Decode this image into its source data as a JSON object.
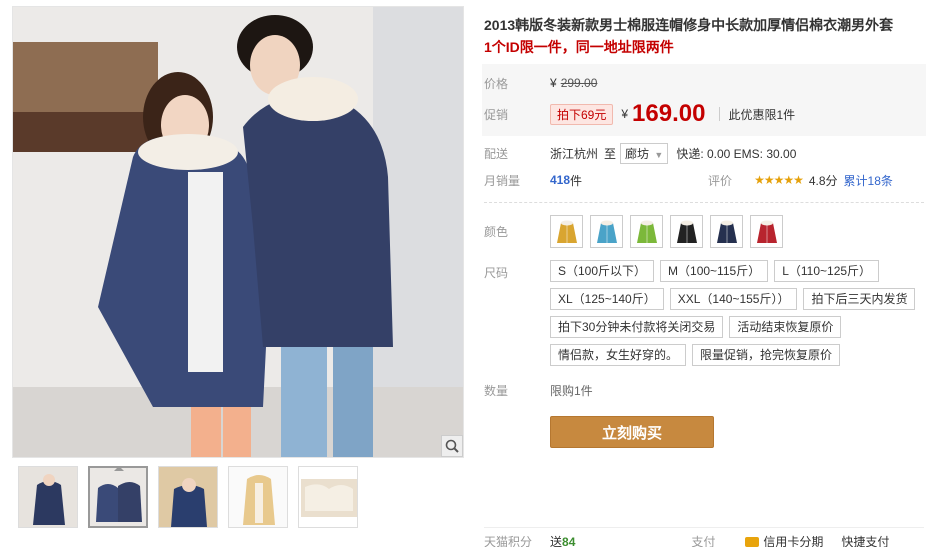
{
  "product": {
    "title": "2013韩版冬装新款男士棉服连帽修身中长款加厚情侣棉衣潮男外套",
    "subtitle": "1个ID限一件，同一地址限两件"
  },
  "price": {
    "label": "价格",
    "currency": "¥",
    "original": "299.00"
  },
  "promo": {
    "label": "促销",
    "tag": "拍下69元",
    "currency": "¥",
    "price": "169.00",
    "note": "此优惠限1件"
  },
  "shipping": {
    "label": "配送",
    "origin": "浙江杭州",
    "to": "至",
    "destination": "廊坊",
    "fees": "快递: 0.00 EMS: 30.00"
  },
  "sales": {
    "label": "月销量",
    "count": "418",
    "unit": "件",
    "rating_label": "评价",
    "stars": "★★★★★",
    "score": "4.8分",
    "total": "累计18条"
  },
  "color": {
    "label": "颜色",
    "options": [
      {
        "name": "yellow",
        "hex": "#d9a530"
      },
      {
        "name": "sky-blue",
        "hex": "#4aa3c8"
      },
      {
        "name": "green",
        "hex": "#7cb83a"
      },
      {
        "name": "black",
        "hex": "#222222"
      },
      {
        "name": "navy",
        "hex": "#25304f"
      },
      {
        "name": "red",
        "hex": "#b8242e"
      }
    ]
  },
  "size": {
    "label": "尺码",
    "options": [
      "S（100斤以下）",
      "M（100~115斤）",
      "L（110~125斤）",
      "XL（125~140斤）",
      "XXL（140~155斤））",
      "拍下后三天内发货",
      "拍下30分钟未付款将关闭交易",
      "活动结束恢复原价",
      "情侣款，女生好穿的。",
      "限量促销，抢完恢复原价"
    ]
  },
  "quantity": {
    "label": "数量",
    "limit": "限购1件"
  },
  "buy_button": "立刻购买",
  "footer": {
    "points_label": "天猫积分",
    "points_prefix": "送",
    "points_value": "84",
    "pay_label": "支付",
    "credit": "信用卡分期",
    "quick": "快捷支付"
  },
  "colors": {
    "accent_red": "#c40000",
    "buy_button": "#c7893f"
  }
}
